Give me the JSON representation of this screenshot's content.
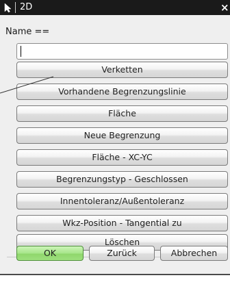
{
  "window": {
    "title": "2D",
    "close_glyph": "×"
  },
  "name_field": {
    "label": "Name  ==",
    "value": ""
  },
  "actions": [
    {
      "label": "Verketten"
    },
    {
      "label": "Vorhandene Begrenzungslinie"
    },
    {
      "label": "Fläche"
    },
    {
      "label": "Neue Begrenzung"
    },
    {
      "label": "Fläche - XC-YC"
    },
    {
      "label": "Begrenzungstyp - Geschlossen"
    },
    {
      "label": "Innentoleranz/Außentoleranz"
    },
    {
      "label": "Wkz-Position - Tangential zu"
    },
    {
      "label": "Löschen"
    }
  ],
  "dialog_buttons": {
    "ok": "OK",
    "back": "Zurück",
    "cancel": "Abbrechen"
  },
  "colors": {
    "titlebar": "#1a1a1a",
    "dialog_bg": "#efefef",
    "ok_green": "#9ee07e"
  },
  "icons": {
    "title": "cursor-arrow-icon",
    "close": "close-icon"
  }
}
